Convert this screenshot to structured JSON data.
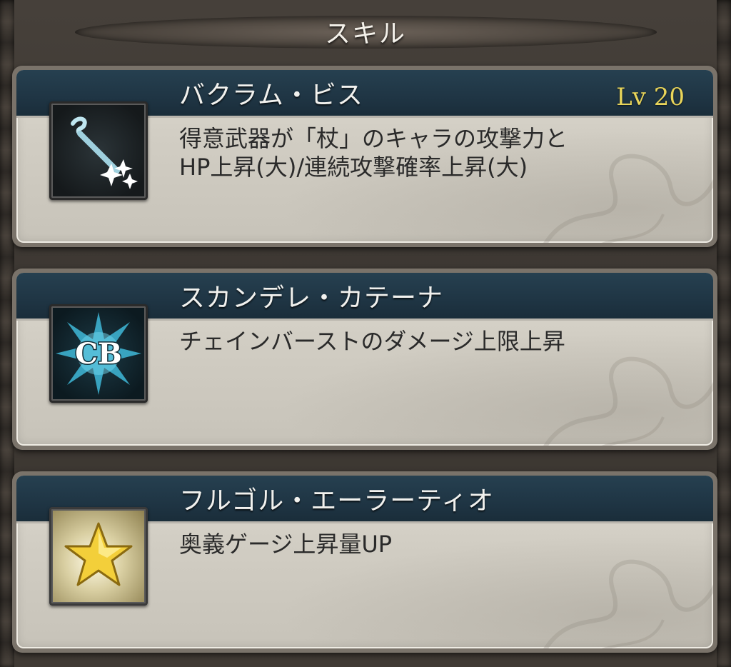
{
  "header": {
    "title": "スキル"
  },
  "skills": [
    {
      "name": "バクラム・ビス",
      "level": "Lv 20",
      "desc_line1": "得意武器が「杖」のキャラの攻撃力と",
      "desc_line2": "HP上昇(大)/連続攻撃確率上昇(大)",
      "icon": "staff-sparkle-icon"
    },
    {
      "name": "スカンデレ・カテーナ",
      "level": "",
      "desc_line1": "チェインバーストのダメージ上限上昇",
      "desc_line2": "",
      "icon": "chain-burst-icon",
      "icon_text": "CB"
    },
    {
      "name": "フルゴル・エーラーティオ",
      "level": "",
      "desc_line1": "奥義ゲージ上昇量UP",
      "desc_line2": "",
      "icon": "gold-star-icon"
    }
  ],
  "colors": {
    "name_bar": "#1f3544",
    "level_text": "#e9d55a",
    "card_body": "#d1cdc3"
  }
}
